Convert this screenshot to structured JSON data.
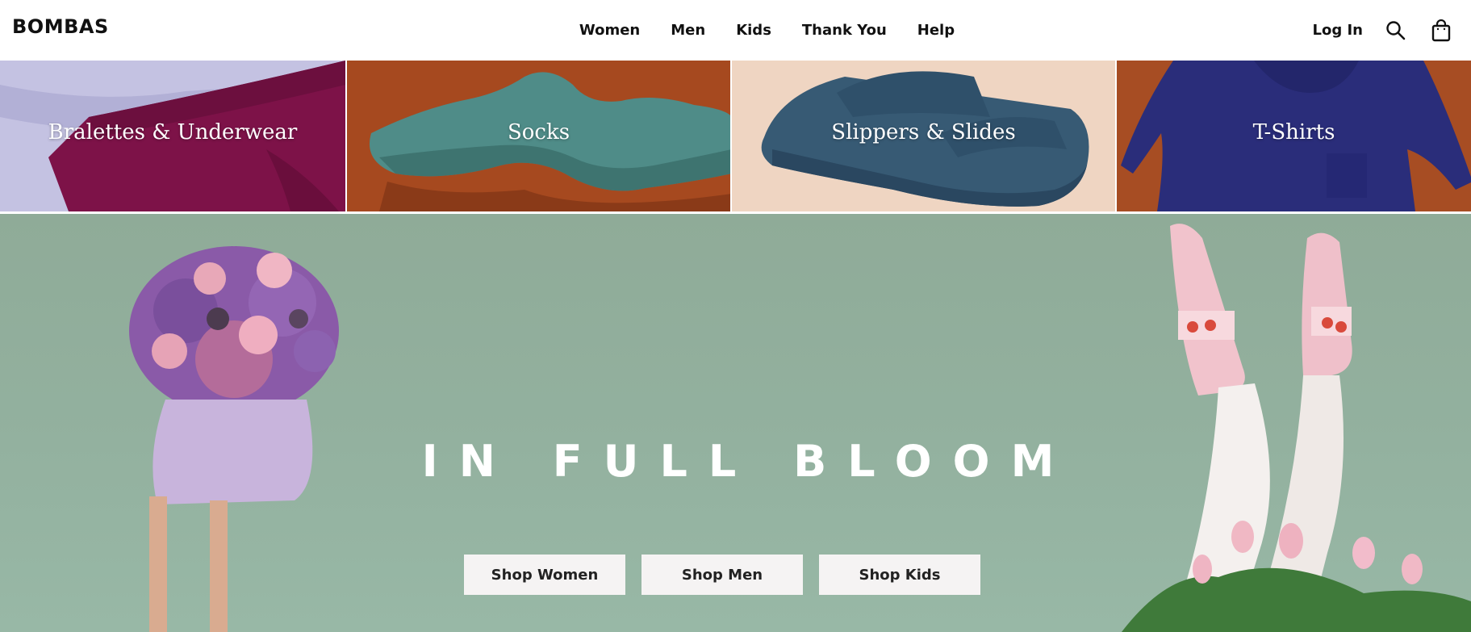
{
  "brand": {
    "logo": "BOMBAS"
  },
  "nav": {
    "items": [
      {
        "label": "Women"
      },
      {
        "label": "Men"
      },
      {
        "label": "Kids"
      },
      {
        "label": "Thank You"
      },
      {
        "label": "Help"
      }
    ],
    "login_label": "Log In",
    "icons": [
      "search-icon",
      "shopping-bag-icon"
    ]
  },
  "categories": [
    {
      "label": "Bralettes & Underwear"
    },
    {
      "label": "Socks"
    },
    {
      "label": "Slippers & Slides"
    },
    {
      "label": "T-Shirts"
    }
  ],
  "hero": {
    "title": "IN FULL BLOOM",
    "buttons": [
      {
        "label": "Shop Women"
      },
      {
        "label": "Shop Men"
      },
      {
        "label": "Shop Kids"
      }
    ]
  },
  "colors": {
    "hero_bg": "#93b19f",
    "button_bg": "#f5f3f3",
    "text_primary": "#111111"
  }
}
